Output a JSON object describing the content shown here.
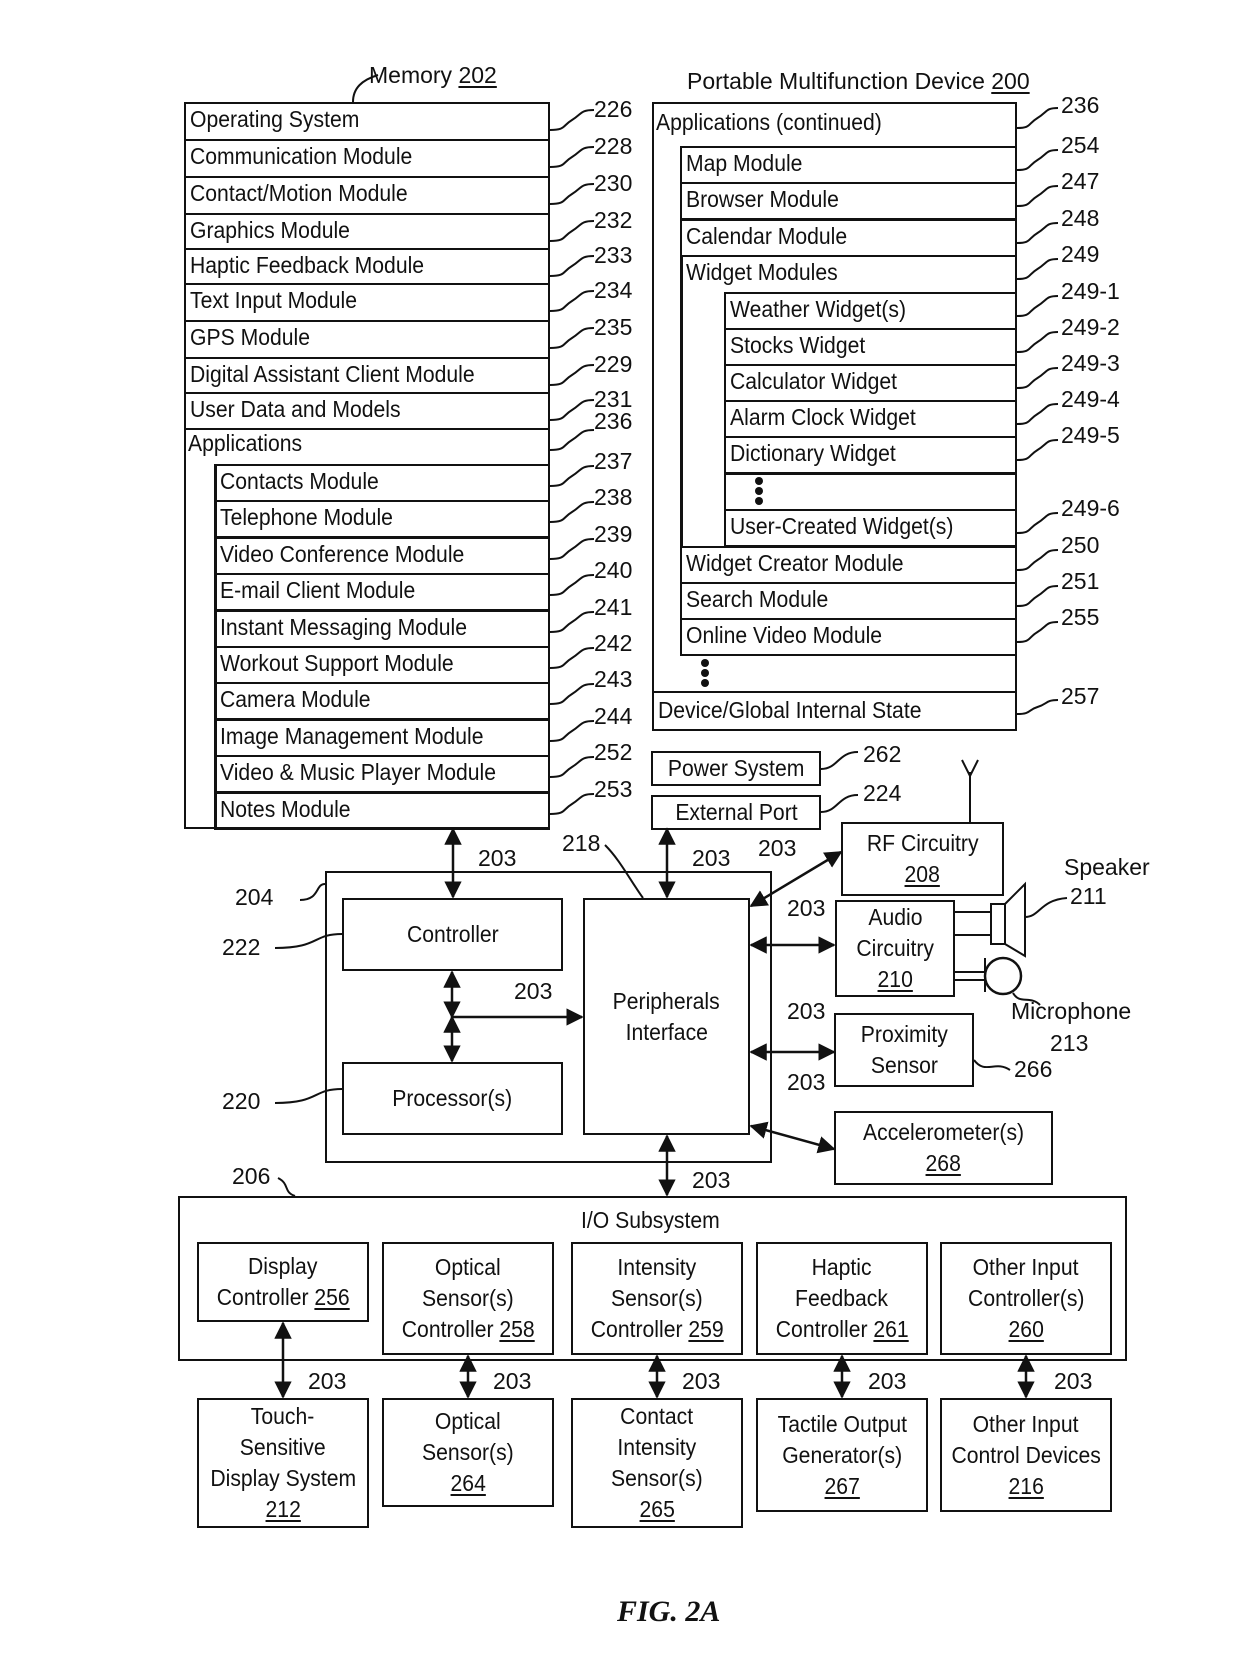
{
  "figure_label": "FIG. 2A",
  "memory": {
    "title": "Memory",
    "ref": "202",
    "rows": [
      {
        "label": "Operating System",
        "ref": "226"
      },
      {
        "label": "Communication Module",
        "ref": "228"
      },
      {
        "label": "Contact/Motion Module",
        "ref": "230"
      },
      {
        "label": "Graphics Module",
        "ref": "232"
      },
      {
        "label": "Haptic Feedback Module",
        "ref": "233"
      },
      {
        "label": "Text Input Module",
        "ref": "234"
      },
      {
        "label": "GPS Module",
        "ref": "235"
      },
      {
        "label": "Digital Assistant Client Module",
        "ref": "229"
      },
      {
        "label": "User Data and Models",
        "ref": "231"
      }
    ],
    "applications": {
      "label": "Applications",
      "ref": "236",
      "modules": [
        {
          "label": "Contacts Module",
          "ref": "237"
        },
        {
          "label": "Telephone Module",
          "ref": "238"
        },
        {
          "label": "Video Conference Module",
          "ref": "239"
        },
        {
          "label": "E-mail Client Module",
          "ref": "240"
        },
        {
          "label": "Instant Messaging Module",
          "ref": "241"
        },
        {
          "label": "Workout Support Module",
          "ref": "242"
        },
        {
          "label": "Camera Module",
          "ref": "243"
        },
        {
          "label": "Image Management Module",
          "ref": "244"
        },
        {
          "label": "Video & Music Player Module",
          "ref": "252"
        },
        {
          "label": "Notes Module",
          "ref": "253"
        }
      ]
    }
  },
  "device": {
    "title": "Portable Multifunction Device",
    "ref": "200",
    "applications_continued": {
      "label": "Applications (continued)",
      "ref": "236",
      "modules": [
        {
          "label": "Map Module",
          "ref": "254"
        },
        {
          "label": "Browser Module",
          "ref": "247"
        },
        {
          "label": "Calendar Module",
          "ref": "248"
        },
        {
          "label": "Widget Modules",
          "ref": "249"
        }
      ],
      "widgets": [
        {
          "label": "Weather Widget(s)",
          "ref": "249-1"
        },
        {
          "label": "Stocks Widget",
          "ref": "249-2"
        },
        {
          "label": "Calculator Widget",
          "ref": "249-3"
        },
        {
          "label": "Alarm Clock Widget",
          "ref": "249-4"
        },
        {
          "label": "Dictionary Widget",
          "ref": "249-5"
        },
        {
          "label": "",
          "ref": ""
        },
        {
          "label": "User-Created Widget(s)",
          "ref": "249-6"
        }
      ],
      "more_modules": [
        {
          "label": "Widget Creator Module",
          "ref": "250"
        },
        {
          "label": "Search Module",
          "ref": "251"
        },
        {
          "label": "Online Video Module",
          "ref": "255"
        }
      ]
    },
    "internal_state": {
      "label": "Device/Global Internal State",
      "ref": "257"
    }
  },
  "power_system": {
    "label": "Power System",
    "ref": "262"
  },
  "external_port": {
    "label": "External Port",
    "ref": "224"
  },
  "bus_ref": "203",
  "chip": {
    "ref": "204",
    "controller": {
      "label": "Controller",
      "ref": "222"
    },
    "processor": {
      "label": "Processor(s)",
      "ref": "220"
    },
    "peripherals": {
      "line1": "Peripherals",
      "line2": "Interface",
      "ref": "218"
    }
  },
  "rf": {
    "line1": "RF Circuitry",
    "num": "208"
  },
  "audio": {
    "line1": "Audio",
    "line2": "Circuitry",
    "num": "210"
  },
  "speaker": {
    "label": "Speaker",
    "ref": "211"
  },
  "microphone": {
    "label": "Microphone",
    "ref": "213"
  },
  "proximity": {
    "line1": "Proximity",
    "line2": "Sensor",
    "ref": "266"
  },
  "accelerometer": {
    "line1": "Accelerometer(s)",
    "num": "268"
  },
  "io": {
    "title": "I/O Subsystem",
    "ref": "206",
    "controllers": [
      {
        "lines": [
          "Display",
          "Controller"
        ],
        "num": "256"
      },
      {
        "lines": [
          "Optical",
          "Sensor(s)",
          "Controller"
        ],
        "num": "258"
      },
      {
        "lines": [
          "Intensity",
          "Sensor(s)",
          "Controller"
        ],
        "num": "259"
      },
      {
        "lines": [
          "Haptic",
          "Feedback",
          "Controller"
        ],
        "num": "261"
      },
      {
        "lines": [
          "Other Input",
          "Controller(s)"
        ],
        "num": "260"
      }
    ],
    "devices": [
      {
        "lines": [
          "Touch-",
          "Sensitive",
          "Display System"
        ],
        "num": "212"
      },
      {
        "lines": [
          "Optical",
          "Sensor(s)"
        ],
        "num": "264"
      },
      {
        "lines": [
          "Contact",
          "Intensity",
          "Sensor(s)"
        ],
        "num": "265"
      },
      {
        "lines": [
          "Tactile Output",
          "Generator(s)"
        ],
        "num": "267"
      },
      {
        "lines": [
          "Other Input",
          "Control Devices"
        ],
        "num": "216"
      }
    ]
  }
}
